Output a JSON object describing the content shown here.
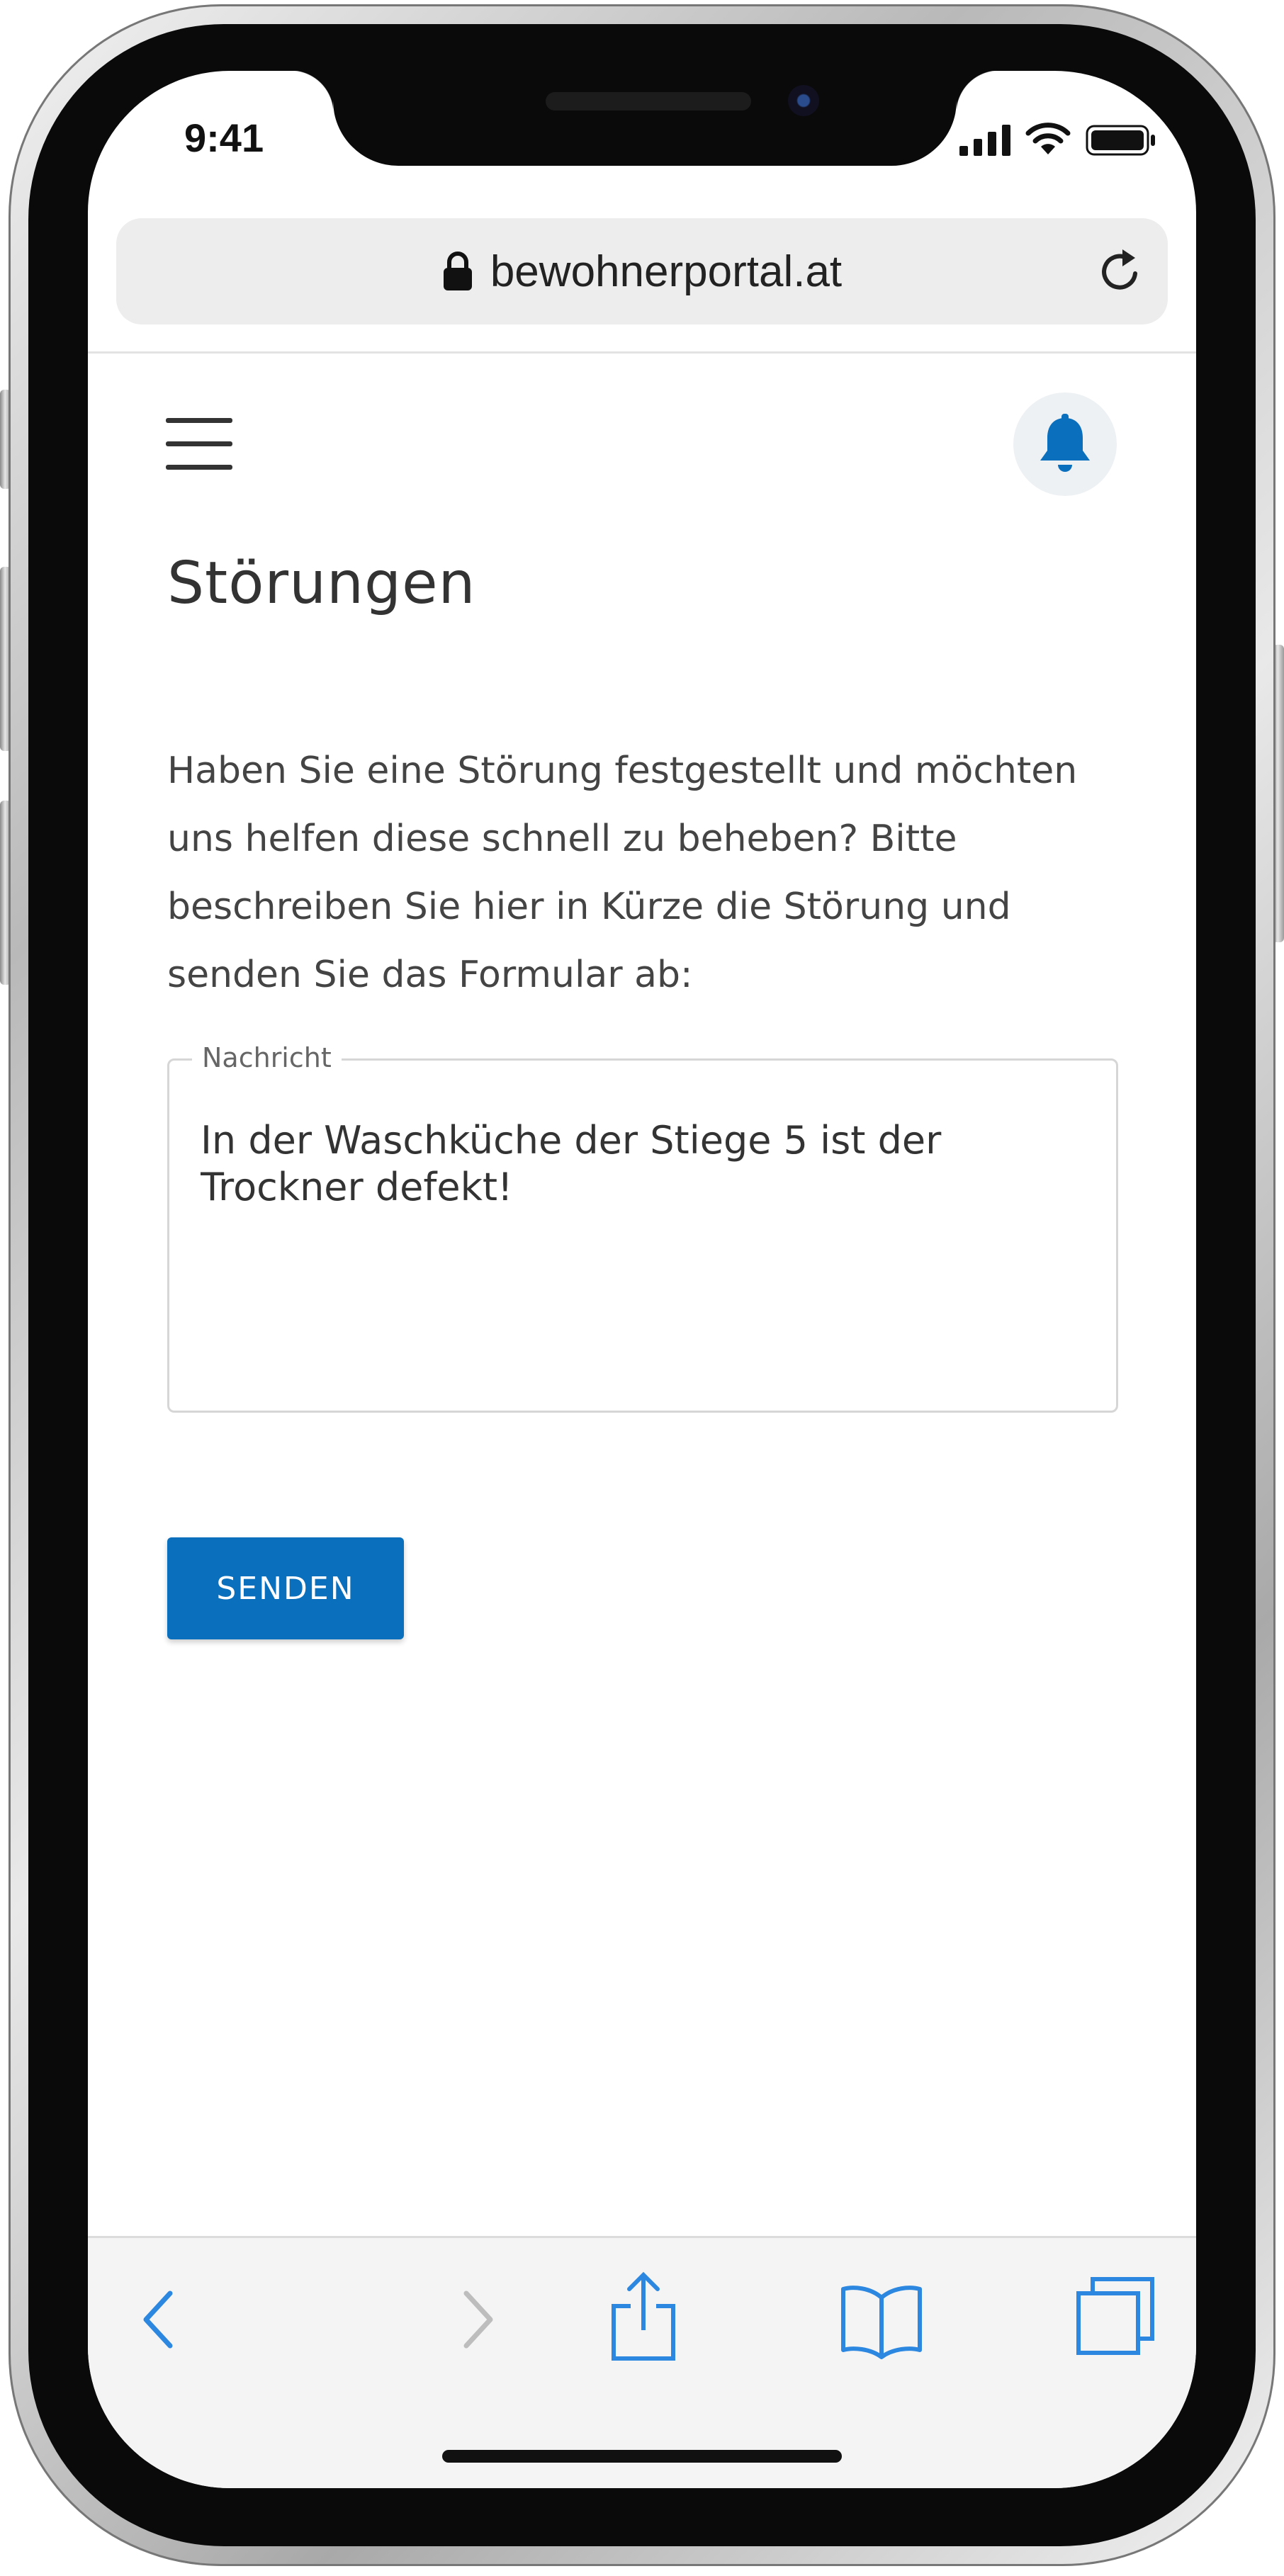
{
  "status_bar": {
    "time": "9:41"
  },
  "browser": {
    "url": "bewohnerportal.at"
  },
  "page": {
    "title": "Störungen",
    "intro": "Haben Sie eine Störung festgestellt und möchten uns helfen diese schnell zu beheben? Bitte beschreiben Sie hier in Kürze die Störung und senden Sie das Formular ab:",
    "message_field": {
      "label": "Nachricht",
      "value": "In der Waschküche der Stiege 5 ist der Trockner defekt!"
    },
    "send_label": "SENDEN"
  },
  "icons": {
    "menu": "hamburger-menu-icon",
    "notifications": "bell-icon",
    "lock": "lock-icon",
    "reload": "reload-icon",
    "back": "chevron-left-icon",
    "forward": "chevron-right-icon",
    "share": "share-icon",
    "bookmarks": "book-icon",
    "tabs": "tabs-icon"
  },
  "colors": {
    "accent": "#0a6fbd",
    "ios_blue": "#2c87e0",
    "bell": "#0a6fbd"
  }
}
